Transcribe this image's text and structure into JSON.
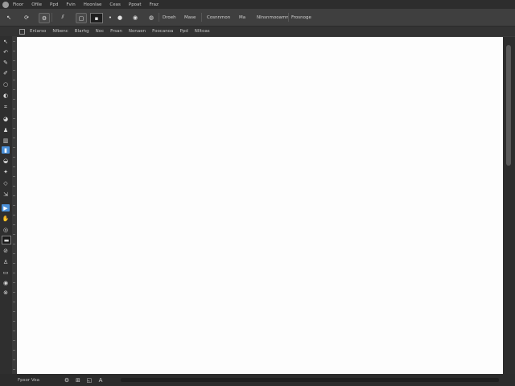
{
  "menubar": {
    "items": [
      "Fioor",
      "Ofile",
      "Ppd",
      "Fvin",
      "Hoonlae",
      "Ceas",
      "Ppoat",
      "Fraz"
    ]
  },
  "toolbar": {
    "labels": [
      "Droeh",
      "Mase",
      "Cosnnmon",
      "Ma",
      "Nlnsnmooamn",
      "Frosnoge"
    ]
  },
  "options": {
    "items": [
      "Enlarso",
      "Nfbenc",
      "Blarhg",
      "Noc",
      "Frsan",
      "Nonaen",
      "Foocanoa",
      "Ppd",
      "Nlltoas"
    ]
  },
  "statusbar": {
    "text": "Fpsor Vea"
  },
  "icons": {
    "tools": [
      "pointer-icon",
      "lasso-icon",
      "brush-icon",
      "pen-icon",
      "circle-tool-icon",
      "shape-icon",
      "crop-icon",
      "eyedropper-icon",
      "stamp-icon",
      "gradient-icon",
      "fill-icon",
      "dodge-icon",
      "text-icon",
      "path-icon",
      "hand-icon",
      "zoom-icon",
      "color-icon",
      "mask-icon",
      "quickmask-icon",
      "screen-icon",
      "camera-icon",
      "extra-icon"
    ]
  }
}
